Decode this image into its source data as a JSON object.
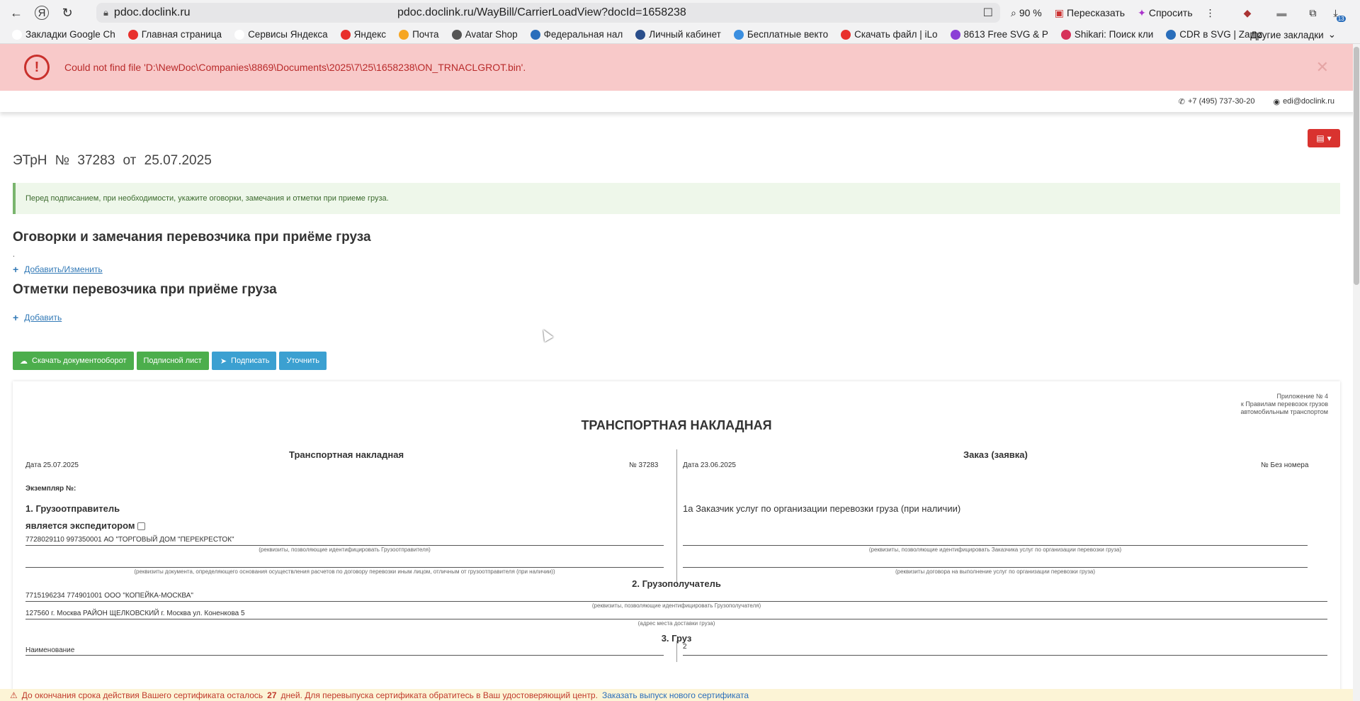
{
  "browser": {
    "host": "pdoc.doclink.ru",
    "url": "pdoc.doclink.ru/WayBill/CarrierLoadView?docId=1658238",
    "zoom": "90 %",
    "retell_label": "Пересказать",
    "ask_label": "Спросить",
    "ext_badge": "13"
  },
  "bookmarks": {
    "items": [
      {
        "label": "Закладки Google Ch",
        "color": "#fff"
      },
      {
        "label": "Главная страница",
        "color": "#e8302c"
      },
      {
        "label": "Сервисы Яндекса",
        "color": "#fff"
      },
      {
        "label": "Яндекс",
        "color": "#e8302c"
      },
      {
        "label": "Почта",
        "color": "#f6a623"
      },
      {
        "label": "Avatar Shop",
        "color": "#555"
      },
      {
        "label": "Федеральная нал",
        "color": "#2a6ebb"
      },
      {
        "label": "Личный кабинет",
        "color": "#2a4e8b"
      },
      {
        "label": "Бесплатные векто",
        "color": "#3b8fe0"
      },
      {
        "label": "Скачать файл | iLo",
        "color": "#e8302c"
      },
      {
        "label": "8613 Free SVG & P",
        "color": "#8b3fd6"
      },
      {
        "label": "Shikari: Поиск кли",
        "color": "#d6325a"
      },
      {
        "label": "CDR в SVG | Zamz",
        "color": "#2a6ebb"
      }
    ],
    "other_label": "Другие закладки"
  },
  "alert": {
    "message": "Could not find file 'D:\\NewDoc\\Companies\\8869\\Documents\\2025\\7\\25\\1658238\\ON_TRNACLGROT.bin'."
  },
  "contacts": {
    "phone": "+7 (495) 737-30-20",
    "email": "edi@doclink.ru"
  },
  "doc": {
    "title": "ЭТрН №   37283   от   25.07.2025",
    "info": "Перед подписанием, при необходимости, укажите оговорки, замечания и отметки при приеме груза.",
    "section1_title": "Оговорки и замечания перевозчика при приёме груза",
    "section1_value": ".",
    "section1_link": "Добавить/Изменить",
    "section2_title": "Отметки перевозчика при приёме груза",
    "section2_link": "Добавить",
    "buttons": {
      "download": "Скачать документооборот",
      "sign_sheet": "Подписной лист",
      "sign": "Подписать",
      "clarify": "Уточнить"
    }
  },
  "sheet": {
    "appendix_1": "Приложение № 4",
    "appendix_2": "к Правилам перевозок грузов",
    "appendix_3": "автомобильным транспортом",
    "title": "ТРАНСПОРТНАЯ НАКЛАДНАЯ",
    "left_title": "Транспортная накладная",
    "left_date": "Дата  25.07.2025",
    "left_number": "№   37283",
    "right_title": "Заказ (заявка)",
    "right_date": "Дата 23.06.2025",
    "right_number": "№ Без номера",
    "copy_label": "Экземпляр №:",
    "shipper_title": "1. Грузоотправитель",
    "shipper_expeditor": "является экспедитором",
    "shipper_value": "7728029110 997350001 АО \"ТОРГОВЫЙ ДОМ \"ПЕРЕКРЕСТОК\"",
    "shipper_cap1": "(реквизиты, позволяющие идентифицировать Грузоотправителя)",
    "shipper_cap2": "(реквизиты документа, определяющего основания осуществления расчетов по договору перевозки иным лицом, отличным от грузоотправителя (при наличии))",
    "customer_title": "1а Заказчик услуг по организации перевозки груза (при наличии)",
    "customer_cap1": "(реквизиты, позволяющие идентифицировать Заказчика услуг по организации перевозки груза)",
    "customer_cap2": "(реквизиты договора на выполнение услуг по организации перевозки груза)",
    "consignee_title": "2. Грузополучатель",
    "consignee_value": "7715196234 774901001 ООО \"КОПЕЙКА-МОСКВА\"",
    "consignee_cap": "(реквизиты, позволяющие идентифицировать Грузополучателя)",
    "address_value": "127560 г. Москва РАЙОН ЩЕЛКОВСКИЙ г. Москва ул. Коненкова 5",
    "address_cap": "(адрес места доставки груза)",
    "cargo_title": "3. Груз",
    "cargo_name_label": "Наименование",
    "cargo_value": "2"
  },
  "cert": {
    "text_a": "До окончания срока действия Вашего сертификата осталось",
    "days": "27",
    "text_b": "дней. Для перевыпуска сертификата обратитесь в Ваш удостоверяющий центр.",
    "link": "Заказать выпуск нового сертификата"
  }
}
